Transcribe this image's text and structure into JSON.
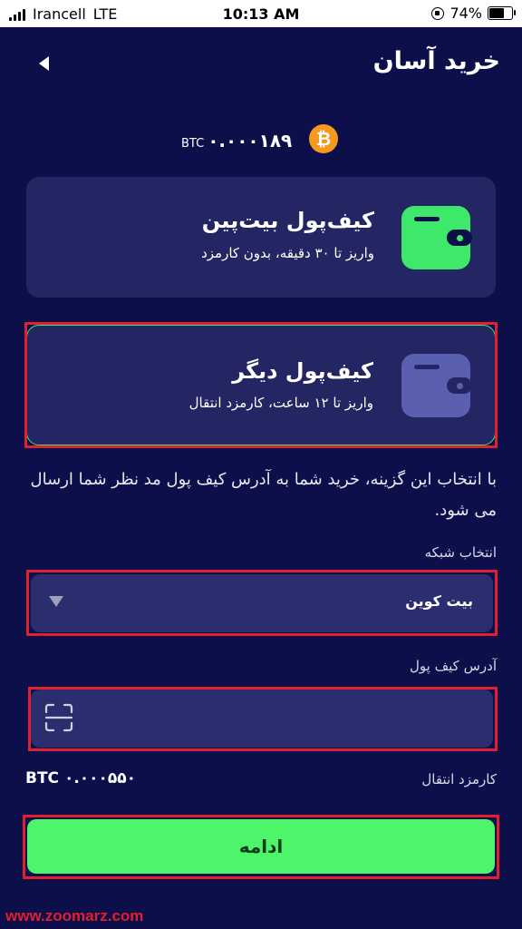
{
  "status_bar": {
    "carrier": "Irancell",
    "network": "LTE",
    "time": "10:13 AM",
    "battery": "74%",
    "battery_level": 0.74
  },
  "header": {
    "title": "خرید آسان",
    "back_icon": "chevron-left-icon"
  },
  "balance": {
    "amount": "۰.۰۰۰۱۸۹",
    "unit": "BTC",
    "coin_symbol": "₿",
    "coin_color": "#f59a1e"
  },
  "options": [
    {
      "title": "کیف‌پول بیت‌پین",
      "subtitle": "واریز تا ۳۰ دقیقه، بدون کارمزد",
      "icon": "wallet-icon",
      "icon_color": "#3ee86a"
    },
    {
      "title": "کیف‌پول دیگر",
      "subtitle": "واریز تا ۱۲ ساعت، کارمزد انتقال",
      "icon": "wallet-icon",
      "icon_color": "#5b5fb0"
    }
  ],
  "info": "با انتخاب این گزینه، خرید شما به آدرس کیف پول مد نظر شما ارسال می شود.",
  "network_field": {
    "label": "انتخاب شبکه",
    "value": "بیت کوین"
  },
  "address_field": {
    "label": "آدرس کیف پول",
    "value": "",
    "icon": "scan-icon"
  },
  "fee": {
    "label": "کارمزد انتقال",
    "value": "۰.۰۰۰۵۵۰",
    "unit": "BTC"
  },
  "continue_label": "ادامه",
  "watermark": "www.zoomarz.com",
  "colors": {
    "background": "#0d0f4a",
    "card": "#232663",
    "accent_green": "#4df56a",
    "highlight_red": "#e0202e"
  }
}
